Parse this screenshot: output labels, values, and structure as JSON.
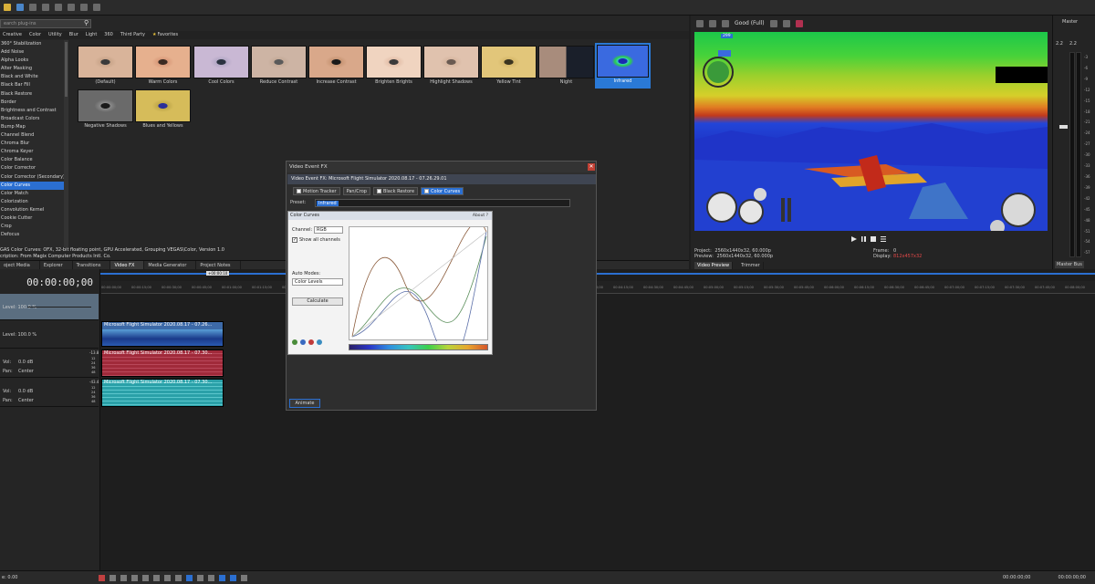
{
  "fx_browser": {
    "search_placeholder": "earch plug-ins",
    "category_tabs": [
      "Creative",
      "Color",
      "Utility",
      "Blur",
      "Light",
      "360",
      "Third Party",
      "Favorites"
    ],
    "plugins": [
      "360° Stabilization",
      "Add Noise",
      "Alpha Looks",
      "Alter Masking",
      "Black and White",
      "Black Bar Fill",
      "Black Restore",
      "Border",
      "Brightness and Contrast",
      "Broadcast Colors",
      "Bump Map",
      "Channel Blend",
      "Chroma Blur",
      "Chroma Keyer",
      "Color Balance",
      "Color Corrector",
      "Color Corrector (Secondary)",
      "Color Curves",
      "Color Match",
      "Colorization",
      "Convolution Kernel",
      "Cookie Cutter",
      "Crop",
      "Defocus"
    ],
    "selected_plugin": "Color Curves",
    "presets": [
      "(Default)",
      "Warm Colors",
      "Cool Colors",
      "Reduce Contrast",
      "Increase Contrast",
      "Brighten Brights",
      "Highlight Shadows",
      "Yellow Tint",
      "Night",
      "Infrared",
      "Negative Shadows",
      "Blues and Yellows"
    ],
    "selected_preset": "Infrared",
    "description_line1": "GAS Color Curves: OFX, 32-bit floating point, GPU Accelerated, Grouping VEGAS\\Color, Version 1.0",
    "description_line2": "cription: From Magix Computer Products Intl. Co."
  },
  "dock_tabs": [
    "oject Media",
    "Explorer",
    "Transitions",
    "Video FX",
    "Media Generator",
    "Project Notes"
  ],
  "preview": {
    "quality": "Good (Full)",
    "project_label": "Project:",
    "project_value": "2560x1440x32, 60.000p",
    "preview_label": "Preview:",
    "preview_value": "2560x1440x32, 60.000p",
    "frame_label": "Frame:",
    "frame_value": "0",
    "display_label": "Display:",
    "display_value": "812x457x32",
    "hud_speed": "299",
    "tabs": [
      "Video Preview",
      "Trimmer"
    ]
  },
  "master": {
    "title": "Master",
    "scale": [
      "-3",
      "-6",
      "-9",
      "-12",
      "-15",
      "-18",
      "-21",
      "-24",
      "-27",
      "-30",
      "-33",
      "-36",
      "-39",
      "-42",
      "-45",
      "-48",
      "-51",
      "-54",
      "-57"
    ],
    "db_left": "2.2",
    "db_right": "2.2",
    "bus_tab": "Master Bus"
  },
  "timeline": {
    "timecode": "00:00:00;00",
    "cursor_label": "+00:00:10",
    "level1": "Level: 100.0 %",
    "level2": "Level: 100.0 %",
    "vol_label": "Vol:",
    "vol_value": "0.0 dB",
    "pan_label": "Pan:",
    "pan_value": "Center",
    "vol2_value": "0.0 dB",
    "pan2_value": "Center",
    "meter1": "-13.8",
    "meter2": "-43.4",
    "meter_scale": [
      "12",
      "24",
      "36",
      "48"
    ],
    "ruler_ticks": [
      "00:00:00;00",
      "00:00:15;00",
      "00:00:30;00",
      "00:00:45;00",
      "00:01:00;00",
      "00:01:15;00",
      "00:01:30;00",
      "00:01:45;00",
      "00:02:00;00",
      "00:02:15;00",
      "00:02:30;00",
      "00:02:45;00",
      "00:03:00;00",
      "00:03:15;00",
      "00:03:30;00",
      "00:03:45;00",
      "00:04:00;00",
      "00:04:15;00",
      "00:04:30;00",
      "00:04:45;00",
      "00:05:00;00",
      "00:05:15;00",
      "00:05:30;00",
      "00:05:45;00",
      "00:06:00;00",
      "00:06:15;00",
      "00:06:30;00",
      "00:06:45;00",
      "00:07:00;00",
      "00:07:15;00",
      "00:07:30;00",
      "00:07:45;00",
      "00:08:00;00"
    ],
    "clip_video": "Microsoft Flight Simulator 2020.08.17 - 07.26...",
    "clip_audio1": "Microsoft Flight Simulator 2020.08.17 - 07.30...",
    "clip_audio2": "Microsoft Flight Simulator 2020.08.17 - 07.30...",
    "rate": "e: 0.00",
    "end_timecode": "00:00:00;00",
    "end_timecode2": "00:00:00;00"
  },
  "vfx_dialog": {
    "title": "Video Event FX",
    "header": "Video Event FX:  Microsoft Flight Simulator 2020.08.17 - 07.26.29.01",
    "chain": [
      "Motion Tracker",
      "Pan/Crop",
      "Black Restore",
      "Color Curves"
    ],
    "preset_label": "Preset:",
    "preset_value": "Infrared",
    "color_curves_title": "Color Curves",
    "about": "About ?",
    "channel_label": "Channel:",
    "channel_value": "RGB",
    "show_all_channels": "Show all channels",
    "auto_modes_label": "Auto Modes:",
    "auto_modes_value": "Color Levels",
    "calculate": "Calculate",
    "animate": "Animate"
  },
  "colors": {
    "accent": "#2b6fd1",
    "video_clip": "#3d6aa8",
    "audio_clip1": "#a02a3a",
    "audio_clip2": "#2aa0a8"
  }
}
